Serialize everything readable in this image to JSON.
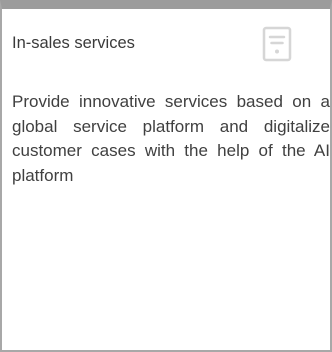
{
  "card": {
    "title": "In-sales services",
    "icon": "document-icon",
    "description": "Provide innovative services based on a global service platform and digitalize customer cases with the help of the AI platform"
  },
  "colors": {
    "top_bar": "#9c9c9c",
    "border": "#a8a8a8",
    "icon": "#d6d6d6",
    "text": "#3a3a3a"
  }
}
